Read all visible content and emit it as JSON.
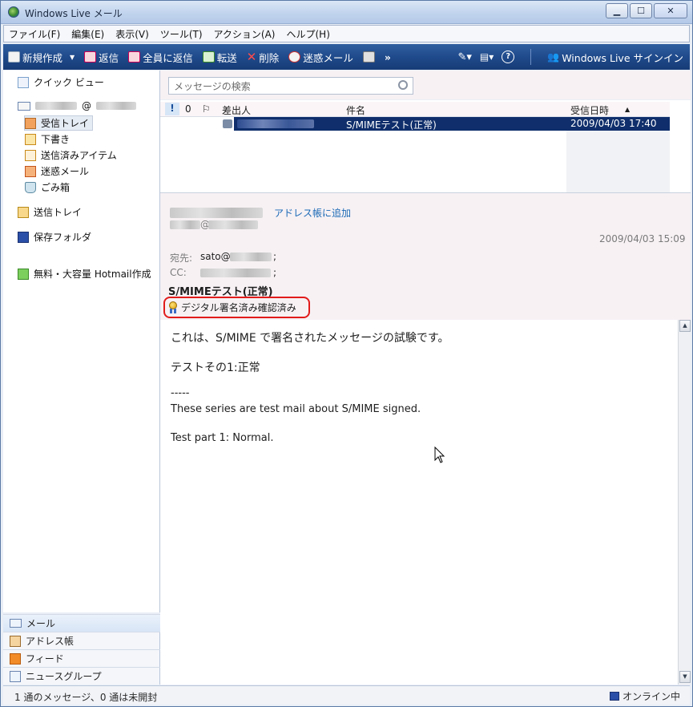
{
  "window": {
    "title": "Windows Live メール",
    "min": "▁",
    "max": "☐",
    "close": "✕"
  },
  "menu": [
    "ファイル(F)",
    "編集(E)",
    "表示(V)",
    "ツール(T)",
    "アクション(A)",
    "ヘルプ(H)"
  ],
  "toolbar": {
    "new": "新規作成",
    "reply": "返信",
    "reply_all": "全員に返信",
    "forward": "転送",
    "delete": "削除",
    "junk": "迷惑メール",
    "more": "»",
    "signin": "Windows Live サインイン"
  },
  "sidebar": {
    "quick_view": "クイック ビュー",
    "account_at": "@",
    "inbox": "受信トレイ",
    "drafts": "下書き",
    "sent": "送信済みアイテム",
    "junk": "迷惑メール",
    "trash": "ごみ箱",
    "outbox": "送信トレイ",
    "storage": "保存フォルダ",
    "hotmail": "無料・大容量 Hotmail作成"
  },
  "nav": [
    "メール",
    "アドレス帳",
    "フィード",
    "ニュースグループ"
  ],
  "search": {
    "placeholder": "メッセージの検索"
  },
  "list": {
    "columns": {
      "flag": "!",
      "attach": "0",
      "watch": "⚐",
      "from": "差出人",
      "subject": "件名",
      "received": "受信日時",
      "sort": "▲"
    },
    "rows": [
      {
        "subject": "S/MIMEテスト(正常)",
        "received": "2009/04/03 17:40"
      }
    ]
  },
  "preview": {
    "add_contact": "アドレス帳に追加",
    "from_domain": "@",
    "date": "2009/04/03 15:09",
    "to_label": "宛先:",
    "to_value": "sato@",
    "to_end": ";",
    "cc_label": "CC:",
    "cc_end": ";",
    "subject": "S/MIMEテスト(正常)",
    "signature": "デジタル署名済み確認済み"
  },
  "body": {
    "line1": "これは、S/MIME で署名されたメッセージの試験です。",
    "line2": "テストその1:正常",
    "line3": "-----",
    "line4": "These series are test mail about S/MIME signed.",
    "line5": "Test part 1: Normal."
  },
  "status": {
    "left": "1 通のメッセージ、0 通は未開封",
    "right": "オンライン中"
  },
  "colors": {
    "toolbar": "#1f4a8b",
    "selection": "#0f2e6b",
    "link": "#1a69b5",
    "highlight_ring": "#e21b1b"
  }
}
